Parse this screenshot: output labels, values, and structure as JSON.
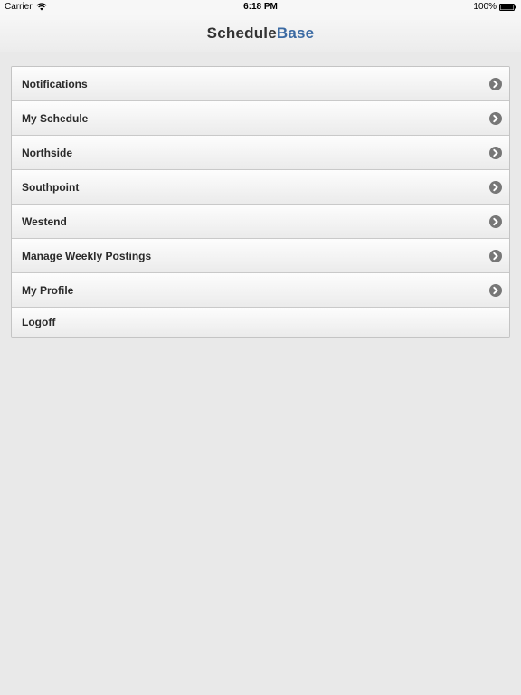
{
  "status_bar": {
    "carrier": "Carrier",
    "time": "6:18 PM",
    "battery": "100%"
  },
  "header": {
    "brand_part1": "Schedule",
    "brand_part2": "Base"
  },
  "menu": {
    "items": [
      {
        "label": "Notifications",
        "icon": "chevron-circle-right-icon"
      },
      {
        "label": "My Schedule",
        "icon": "chevron-circle-right-icon"
      },
      {
        "label": "Northside",
        "icon": "chevron-circle-right-icon"
      },
      {
        "label": "Southpoint",
        "icon": "chevron-circle-right-icon"
      },
      {
        "label": "Westend",
        "icon": "chevron-circle-right-icon"
      },
      {
        "label": "Manage Weekly Postings",
        "icon": "chevron-circle-right-icon"
      },
      {
        "label": "My Profile",
        "icon": "chevron-circle-right-icon"
      },
      {
        "label": "Logoff"
      }
    ]
  },
  "colors": {
    "background": "#e9e9e9",
    "brand_accent": "#3b6aa3",
    "brand_text": "#333333",
    "arrow_icon": "#777777"
  }
}
